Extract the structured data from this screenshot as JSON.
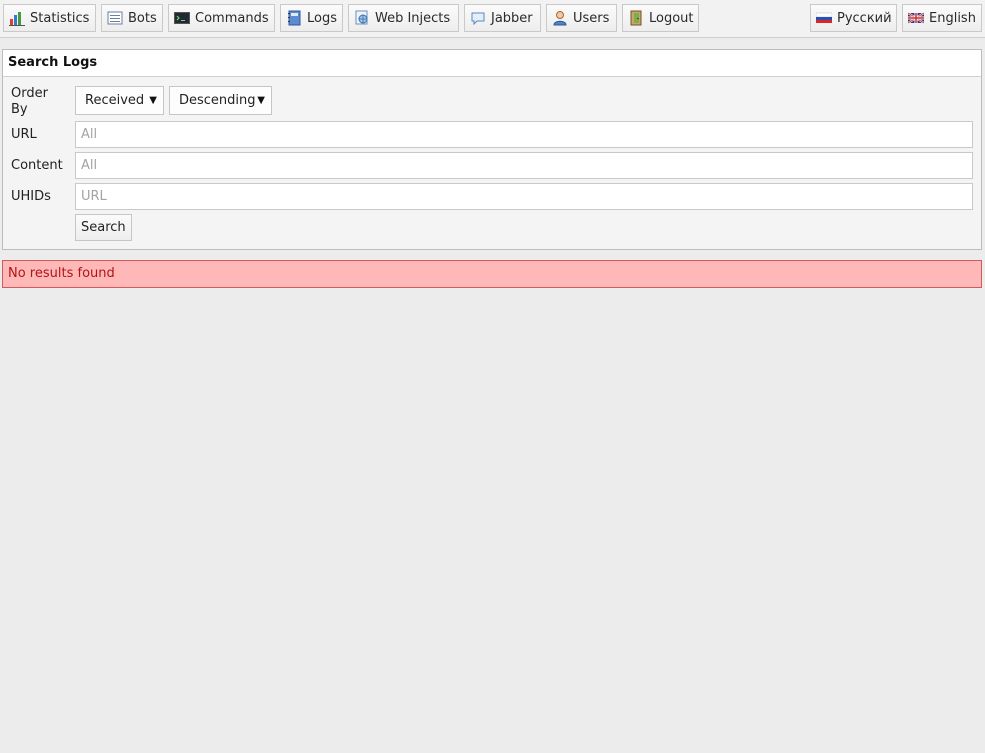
{
  "nav": {
    "items": [
      {
        "label": "Statistics",
        "icon": "bar-chart-icon"
      },
      {
        "label": "Bots",
        "icon": "list-icon"
      },
      {
        "label": "Commands",
        "icon": "terminal-icon"
      },
      {
        "label": "Logs",
        "icon": "notebook-icon"
      },
      {
        "label": "Web Injects",
        "icon": "web-inject-icon"
      },
      {
        "label": "Jabber",
        "icon": "chat-bubble-icon"
      },
      {
        "label": "Users",
        "icon": "user-icon"
      },
      {
        "label": "Logout",
        "icon": "exit-door-icon"
      }
    ],
    "languages": [
      {
        "label": "Русский",
        "icon": "russian-flag-icon"
      },
      {
        "label": "English",
        "icon": "uk-flag-icon"
      }
    ]
  },
  "search_panel": {
    "title": "Search Logs",
    "order_by_label": "Order By",
    "order_by_value": "Received",
    "order_direction_value": "Descending",
    "url_label": "URL",
    "url_placeholder": "All",
    "content_label": "Content",
    "content_placeholder": "All",
    "uhids_label": "UHIDs",
    "uhids_placeholder": "URL",
    "search_button": "Search"
  },
  "alert": {
    "message": "No results found"
  },
  "colors": {
    "alert_background": "#ffb8b8",
    "alert_border": "#d35a5a",
    "alert_text": "#b01515"
  }
}
